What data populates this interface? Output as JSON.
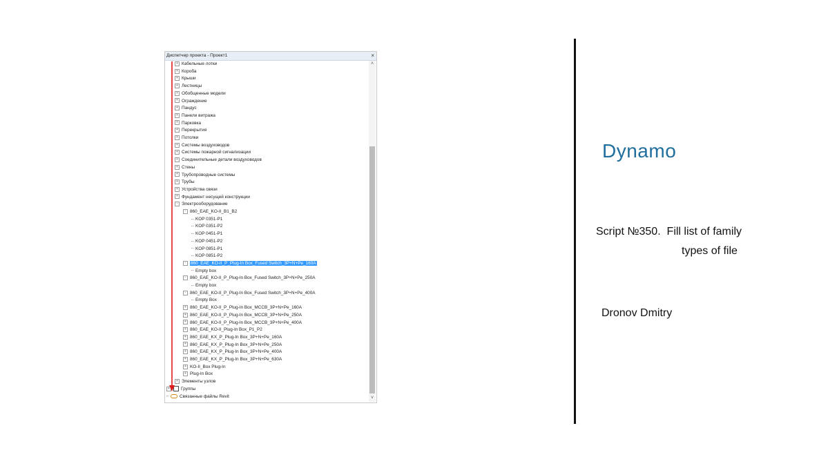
{
  "project_browser": {
    "title": "Диспетчер проекта - Проект1",
    "close": "×",
    "scroll_up": "˄",
    "scroll_down": "˅",
    "rows": [
      {
        "level": 1,
        "toggle": "+",
        "label": "Кабельные лотки"
      },
      {
        "level": 1,
        "toggle": "+",
        "label": "Короба"
      },
      {
        "level": 1,
        "toggle": "+",
        "label": "Крыши"
      },
      {
        "level": 1,
        "toggle": "+",
        "label": "Лестницы"
      },
      {
        "level": 1,
        "toggle": "+",
        "label": "Обобщенные модели"
      },
      {
        "level": 1,
        "toggle": "+",
        "label": "Ограждение"
      },
      {
        "level": 1,
        "toggle": "+",
        "label": "Пандус"
      },
      {
        "level": 1,
        "toggle": "+",
        "label": "Панели витража"
      },
      {
        "level": 1,
        "toggle": "+",
        "label": "Парковка"
      },
      {
        "level": 1,
        "toggle": "+",
        "label": "Перекрытия"
      },
      {
        "level": 1,
        "toggle": "+",
        "label": "Потолки"
      },
      {
        "level": 1,
        "toggle": "+",
        "label": "Системы воздуховодов"
      },
      {
        "level": 1,
        "toggle": "+",
        "label": "Системы пожарной сигнализации"
      },
      {
        "level": 1,
        "toggle": "+",
        "label": "Соединительные детали воздуховодов"
      },
      {
        "level": 1,
        "toggle": "+",
        "label": "Стены"
      },
      {
        "level": 1,
        "toggle": "+",
        "label": "Трубопроводные системы"
      },
      {
        "level": 1,
        "toggle": "+",
        "label": "Трубы"
      },
      {
        "level": 1,
        "toggle": "+",
        "label": "Устройства связи"
      },
      {
        "level": 1,
        "toggle": "+",
        "label": "Фундамент несущей конструкции"
      },
      {
        "level": 1,
        "toggle": "-",
        "label": "Электрооборудование"
      },
      {
        "level": 2,
        "toggle": "-",
        "label": "860_EAE_KO-II_B1_B2"
      },
      {
        "level": 3,
        "toggle": "",
        "label": "KOP 0351-P1"
      },
      {
        "level": 3,
        "toggle": "",
        "label": "KOP 0351-P2"
      },
      {
        "level": 3,
        "toggle": "",
        "label": "KOP 0451-P1"
      },
      {
        "level": 3,
        "toggle": "",
        "label": "KOP 0451-P2"
      },
      {
        "level": 3,
        "toggle": "",
        "label": "KOP 0851-P1"
      },
      {
        "level": 3,
        "toggle": "",
        "label": "KOP 0851-P2"
      },
      {
        "level": 2,
        "toggle": "-",
        "label": "860_EAE_KO-II_P_Plug-In Box_Fused Switch_3P+N+Pe_160A",
        "selected": true
      },
      {
        "level": 3,
        "toggle": "",
        "label": "Empty box"
      },
      {
        "level": 2,
        "toggle": "-",
        "label": "860_EAE_KO-II_P_Plug-In Box_Fused Switch_3P+N+Pe_250A"
      },
      {
        "level": 3,
        "toggle": "",
        "label": "Empty box"
      },
      {
        "level": 2,
        "toggle": "-",
        "label": "860_EAE_KO-II_P_Plug-In Box_Fused Switch_3P+N+Pe_400A"
      },
      {
        "level": 3,
        "toggle": "",
        "label": "Empty Box"
      },
      {
        "level": 2,
        "toggle": "+",
        "label": "860_EAE_KO-II_P_Plug-In Box_MCCB_3P+N+Pe_160A"
      },
      {
        "level": 2,
        "toggle": "+",
        "label": "860_EAE_KO-II_P_Plug-In Box_MCCB_3P+N+Pe_250A"
      },
      {
        "level": 2,
        "toggle": "+",
        "label": "860_EAE_KO-II_P_Plug-In Box_MCCB_3P+N+Pe_400A"
      },
      {
        "level": 2,
        "toggle": "+",
        "label": "860_EAE_KO-II_Plug-In Box_P1_P2"
      },
      {
        "level": 2,
        "toggle": "+",
        "label": "860_EAE_KX_P_Plug-In Box_3P+N+Pe_160A"
      },
      {
        "level": 2,
        "toggle": "+",
        "label": "860_EAE_KX_P_Plug-In Box_3P+N+Pe_250A"
      },
      {
        "level": 2,
        "toggle": "+",
        "label": "860_EAE_KX_P_Plug-In Box_3P+N+Pe_400A"
      },
      {
        "level": 2,
        "toggle": "+",
        "label": "860_EAE_KX_P_Plug-In Box_3P+N+Pe_630A"
      },
      {
        "level": 2,
        "toggle": "+",
        "label": "KO-II_Box Plug-In"
      },
      {
        "level": 2,
        "toggle": "+",
        "label": "Plug-In Box"
      },
      {
        "level": 1,
        "toggle": "+",
        "label": "Элементы узлов"
      },
      {
        "level": 0,
        "toggle": "+",
        "icon": "group",
        "label": "Группы"
      },
      {
        "level": 0,
        "toggle": "",
        "icon": "link",
        "label": "Связанные файлы Revit"
      }
    ]
  },
  "slide": {
    "title": "Dynamo",
    "script_line1": "Script №350.  Fill list of family",
    "script_line2": "types of file",
    "author": "Dronov Dmitry"
  },
  "colors": {
    "accent": "#1f6e9e",
    "selection": "#3399ff",
    "arrow": "#e01a1a"
  }
}
